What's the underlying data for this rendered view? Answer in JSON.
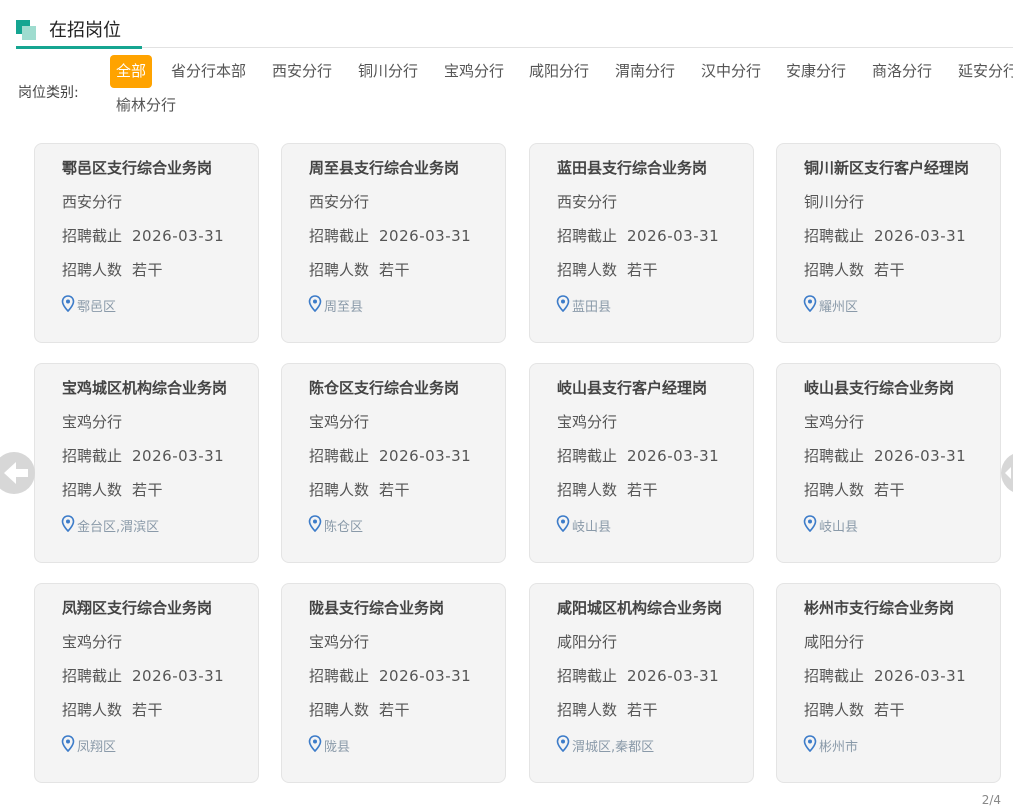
{
  "header": {
    "title": "在招岗位"
  },
  "filter": {
    "label": "岗位类别:",
    "chips": [
      "全部",
      "省分行本部",
      "西安分行",
      "铜川分行",
      "宝鸡分行",
      "咸阳分行",
      "渭南分行",
      "汉中分行",
      "安康分行",
      "商洛分行",
      "延安分行",
      "榆林分行"
    ],
    "active": "全部"
  },
  "labels": {
    "deadline": "招聘截止",
    "headcount": "招聘人数"
  },
  "jobs": [
    {
      "title": "鄠邑区支行综合业务岗",
      "branch": "西安分行",
      "deadline": "2026-03-31",
      "headcount": "若干",
      "location": "鄠邑区"
    },
    {
      "title": "周至县支行综合业务岗",
      "branch": "西安分行",
      "deadline": "2026-03-31",
      "headcount": "若干",
      "location": "周至县"
    },
    {
      "title": "蓝田县支行综合业务岗",
      "branch": "西安分行",
      "deadline": "2026-03-31",
      "headcount": "若干",
      "location": "蓝田县"
    },
    {
      "title": "铜川新区支行客户经理岗",
      "branch": "铜川分行",
      "deadline": "2026-03-31",
      "headcount": "若干",
      "location": "耀州区"
    },
    {
      "title": "宝鸡城区机构综合业务岗",
      "branch": "宝鸡分行",
      "deadline": "2026-03-31",
      "headcount": "若干",
      "location": "金台区,渭滨区"
    },
    {
      "title": "陈仓区支行综合业务岗",
      "branch": "宝鸡分行",
      "deadline": "2026-03-31",
      "headcount": "若干",
      "location": "陈仓区"
    },
    {
      "title": "岐山县支行客户经理岗",
      "branch": "宝鸡分行",
      "deadline": "2026-03-31",
      "headcount": "若干",
      "location": "岐山县"
    },
    {
      "title": "岐山县支行综合业务岗",
      "branch": "宝鸡分行",
      "deadline": "2026-03-31",
      "headcount": "若干",
      "location": "岐山县"
    },
    {
      "title": "凤翔区支行综合业务岗",
      "branch": "宝鸡分行",
      "deadline": "2026-03-31",
      "headcount": "若干",
      "location": "凤翔区"
    },
    {
      "title": "陇县支行综合业务岗",
      "branch": "宝鸡分行",
      "deadline": "2026-03-31",
      "headcount": "若干",
      "location": "陇县"
    },
    {
      "title": "咸阳城区机构综合业务岗",
      "branch": "咸阳分行",
      "deadline": "2026-03-31",
      "headcount": "若干",
      "location": "渭城区,秦都区"
    },
    {
      "title": "彬州市支行综合业务岗",
      "branch": "咸阳分行",
      "deadline": "2026-03-31",
      "headcount": "若干",
      "location": "彬州市"
    }
  ],
  "pager": {
    "text": "2/4"
  },
  "colors": {
    "accent": "#15a591",
    "active_chip": "#ffa300",
    "card_bg": "#f4f4f4",
    "pin": "#3d7cc9"
  },
  "icons": {
    "location": "location-pin-icon",
    "prev": "arrow-left-icon",
    "next": "arrow-right-icon"
  }
}
